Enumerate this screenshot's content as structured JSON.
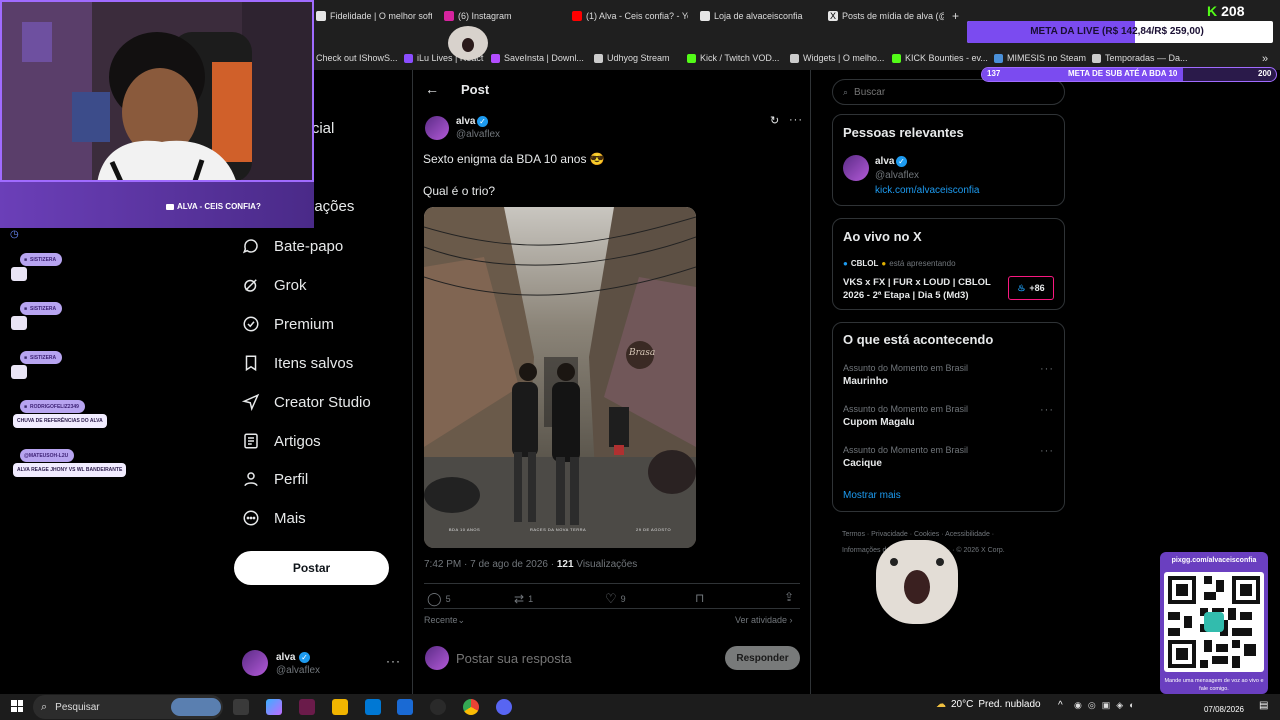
{
  "browser": {
    "tabs": [
      {
        "label": "Fidelidade | O melhor softw",
        "color": "#e6e6e6"
      },
      {
        "label": "(6) Instagram",
        "color": "#d6249f"
      },
      {
        "label": "(1) Alva - Ceis confia? - Yo",
        "color": "#ff0000"
      },
      {
        "label": "Loja de alvaceisconfia",
        "color": "#e6e6e6"
      },
      {
        "label": "Posts de mídia de alva (@a",
        "color": "#e6e6e6"
      },
      {
        "label": "+",
        "color": ""
      }
    ],
    "bookmarks": [
      {
        "label": "Check out IShowS...",
        "color": "#888888"
      },
      {
        "label": "iLu Lives | React",
        "color": "#8a4dff"
      },
      {
        "label": "SaveInsta | Downl...",
        "color": "#b34dff"
      },
      {
        "label": "Udhyog Stream",
        "color": "#cccccc"
      },
      {
        "label": "Kick / Twitch VOD...",
        "color": "#53fc18"
      },
      {
        "label": "Widgets | O melho...",
        "color": "#cccccc"
      },
      {
        "label": "KICK Bounties - ev...",
        "color": "#53fc18"
      },
      {
        "label": "MIMESIS no Steam",
        "color": "#4a90d9"
      },
      {
        "label": "Temporadas — Da...",
        "color": "#cccccc"
      }
    ]
  },
  "stream": {
    "viewer_count": "208",
    "meta_live": "META DA LIVE (R$ 142,84/R$ 259,00)",
    "meta_live_fill": 0.55,
    "meta_sub_current": "137",
    "meta_sub_label": "META DE SUB ATÉ A BDA 10",
    "meta_sub_target": "200",
    "meta_sub_fill": 0.685,
    "cam_banner": "ALVA - CEIS CONFIA?",
    "chat": [
      {
        "user": "SISTIZERA",
        "message": ""
      },
      {
        "user": "SISTIZERA",
        "message": ""
      },
      {
        "user": "SISTIZERA",
        "message": ""
      },
      {
        "user": "RODRIGOFELIZ2349",
        "message": "CHUVA DE REFERÊNCIAS DO ALVA"
      },
      {
        "user": "@MATEUSOH-L2U",
        "message": "ALVA REAGE JHONY VS WL BANDEIRANTE"
      }
    ],
    "qr_url": "pixgg.com/alvaceisconfia",
    "qr_caption": "Mande uma mensagem de voz ao vivo e fale comigo."
  },
  "left_nav": {
    "items": [
      {
        "label": "Inicial",
        "icon": "home-icon"
      },
      {
        "label": "ar",
        "icon": "search-icon"
      },
      {
        "label": "ificações",
        "icon": "bell-icon"
      },
      {
        "label": "Bate-papo",
        "icon": "chat-icon"
      },
      {
        "label": "Grok",
        "icon": "grok-icon"
      },
      {
        "label": "Premium",
        "icon": "premium-icon"
      },
      {
        "label": "Itens salvos",
        "icon": "bookmark-icon"
      },
      {
        "label": "Creator Studio",
        "icon": "rocket-icon"
      },
      {
        "label": "Artigos",
        "icon": "articles-icon"
      },
      {
        "label": "Perfil",
        "icon": "person-icon"
      },
      {
        "label": "Mais",
        "icon": "more-icon"
      }
    ],
    "post_button": "Postar",
    "account": {
      "name": "alva",
      "handle": "@alvaflex"
    }
  },
  "post": {
    "header": "Post",
    "author": {
      "name": "alva",
      "handle": "@alvaflex"
    },
    "text_line1": "Sexto enigma da BDA 10 anos 😎",
    "text_line2": "Qual é o trio?",
    "image_caption": [
      "BDA 10 ANOS",
      "RACES DA NOVA TERRA",
      "29 DE AGOSTO"
    ],
    "image_sign": "Brasa",
    "timestamp": "7:42 PM · 7 de ago de 2026 · ",
    "views_count": "121",
    "views_label": "Visualizações",
    "replies": "5",
    "reposts": "1",
    "likes": "9",
    "sort_label": "Recente",
    "activity_label": "Ver atividade",
    "reply_placeholder": "Postar sua resposta",
    "reply_button": "Responder"
  },
  "right_sidebar": {
    "search_placeholder": "Buscar",
    "relevant_title": "Pessoas relevantes",
    "relevant_person": {
      "name": "alva",
      "handle": "@alvaflex",
      "link": "kick.com/alvaceisconfia"
    },
    "live_title": "Ao vivo no X",
    "live_host": "CBLOL",
    "live_host_suffix": "está apresentando",
    "live_title_line1": "VKS x FX | FUR x LOUD | CBLOL",
    "live_title_line2": "2026 - 2ª Etapa | Dia 5 (Md3)",
    "live_count": "+86",
    "trends_title": "O que está acontecendo",
    "trends": [
      {
        "category": "Assunto do Momento em Brasil",
        "name": "Maurinho"
      },
      {
        "category": "Assunto do Momento em Brasil",
        "name": "Cupom Magalu"
      },
      {
        "category": "Assunto do Momento em Brasil",
        "name": "Cacique"
      }
    ],
    "show_more": "Mostrar mais",
    "footer_line1": "Termos  ·  Privacidade  ·  Cookies  ·  Acessibilidade  ·",
    "footer_line2": "Informações de anúncios  ·  Mais ···  ·  © 2026 X Corp."
  },
  "taskbar": {
    "search_label": "Pesquisar",
    "weather_temp": "20°C",
    "weather_desc": "Pred. nublado",
    "date": "07/08/2026"
  }
}
